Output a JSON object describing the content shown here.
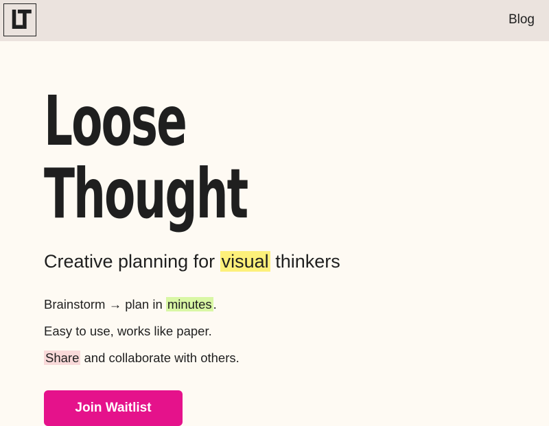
{
  "header": {
    "logo_text": "LT",
    "nav_blog": "Blog"
  },
  "hero": {
    "title_line1": "Loose",
    "title_line2": "Thought",
    "tagline_pre": "Creative planning for ",
    "tagline_highlight": "visual",
    "tagline_post": " thinkers"
  },
  "features": [
    {
      "pre": "Brainstorm → plan in ",
      "highlight": "minutes",
      "post": "."
    },
    {
      "text": "Easy to use, works like paper."
    },
    {
      "highlight": "Share",
      "post": " and collaborate with others."
    }
  ],
  "cta": {
    "label": "Join Waitlist"
  },
  "colors": {
    "header_bg": "#ebe3de",
    "page_bg": "#fefaf3",
    "highlight_yellow": "#fdf07a",
    "highlight_green": "#d9f7a5",
    "highlight_pink": "#f9d9d9",
    "cta_bg": "#e5128b"
  }
}
